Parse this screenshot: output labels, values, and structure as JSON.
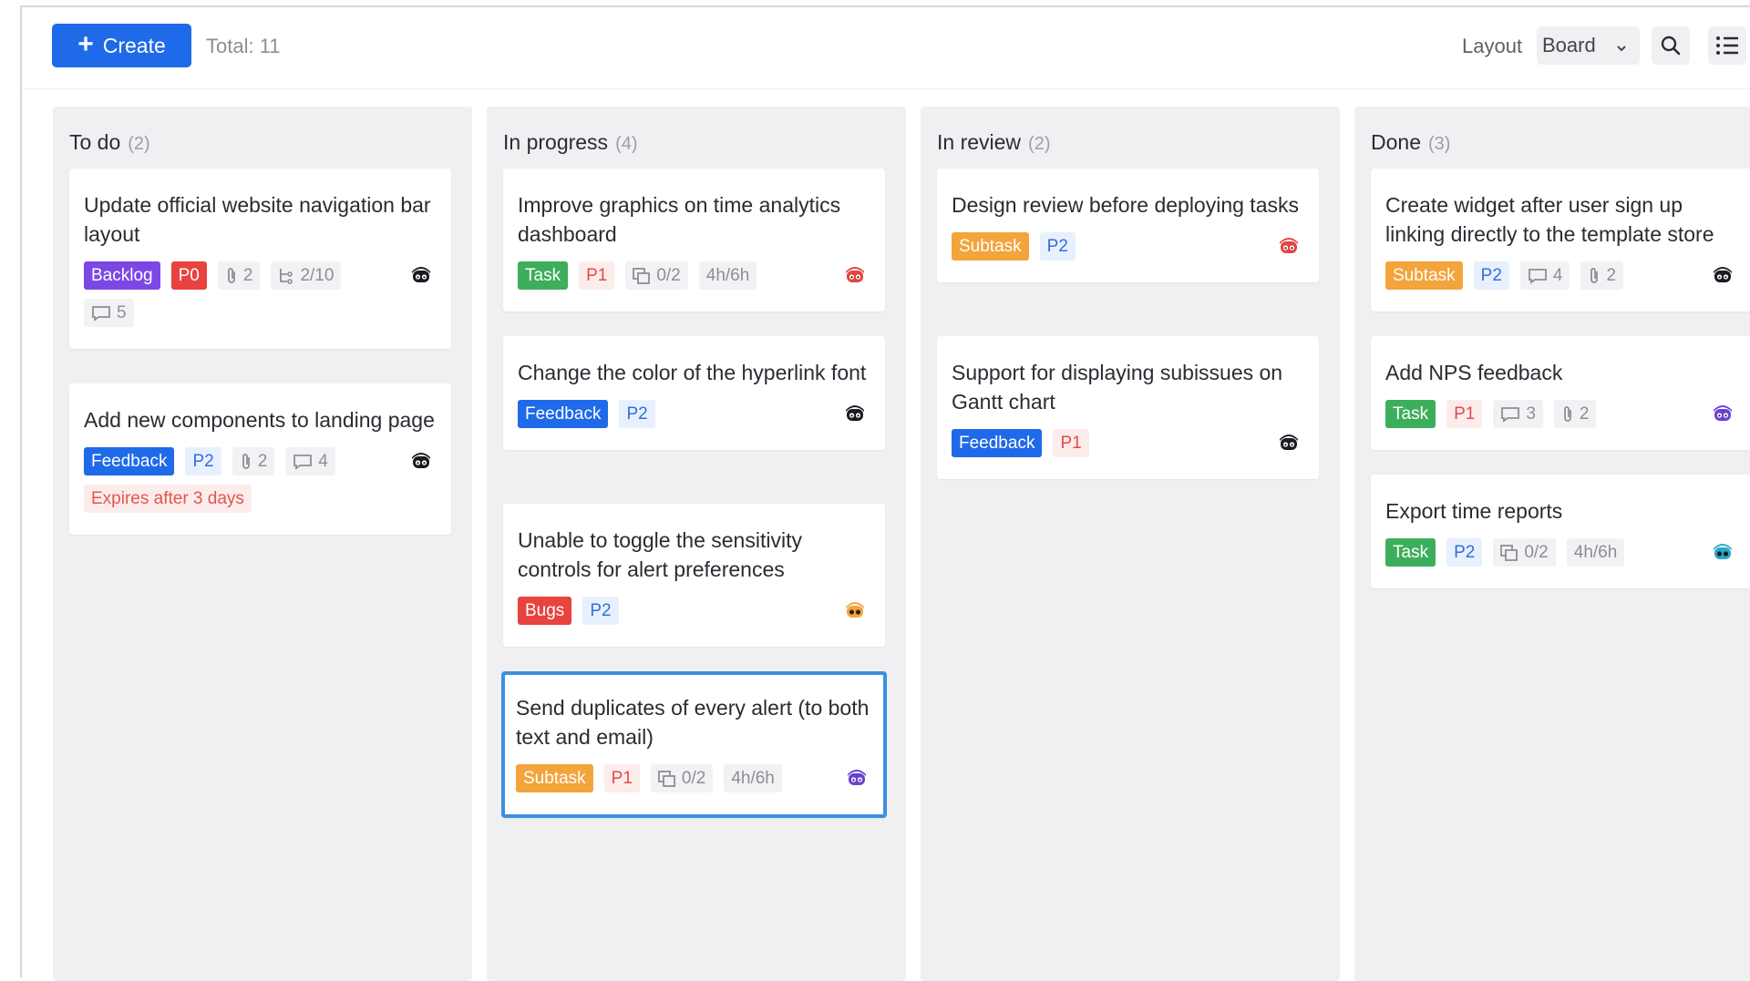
{
  "toolbar": {
    "create_label": "Create",
    "total": "Total: 11",
    "layout_label": "Layout",
    "layout_value": "Board"
  },
  "colors": {
    "accent": "#1f6ae8",
    "backlog": "#7b48e6",
    "p0": "#e8433f",
    "task": "#3dae5c",
    "subtask": "#f3a43a",
    "selected_border": "#3b8fe0"
  },
  "columns": [
    {
      "title": "To do",
      "count": "(2)",
      "cards": [
        {
          "title": "Update official website navigation bar layout",
          "tags": [
            {
              "text": "Backlog",
              "kind": "backlog"
            },
            {
              "text": "P0",
              "kind": "p0"
            },
            {
              "text": "2",
              "kind": "meta",
              "icon": "attachment-icon"
            },
            {
              "text": "2/10",
              "kind": "meta",
              "icon": "subtask-tree-icon"
            },
            {
              "text": "5",
              "kind": "meta",
              "icon": "comment-icon"
            }
          ],
          "avatar": "avatar-dark"
        },
        {
          "title": "Add new components to landing page",
          "tags": [
            {
              "text": "Feedback",
              "kind": "feedback"
            },
            {
              "text": "P2",
              "kind": "p2"
            },
            {
              "text": "2",
              "kind": "meta",
              "icon": "attachment-icon"
            },
            {
              "text": "4",
              "kind": "meta",
              "icon": "comment-icon"
            },
            {
              "text": "Expires after 3 days",
              "kind": "expire"
            }
          ],
          "avatar": "avatar-dark"
        }
      ]
    },
    {
      "title": "In progress",
      "count": "(4)",
      "cards": [
        {
          "title": "Improve graphics on time analytics dashboard",
          "tags": [
            {
              "text": "Task",
              "kind": "task"
            },
            {
              "text": "P1",
              "kind": "p1"
            },
            {
              "text": "0/2",
              "kind": "meta",
              "icon": "copy-icon"
            },
            {
              "text": "4h/6h",
              "kind": "meta"
            }
          ],
          "avatar": "avatar-red"
        },
        {
          "title": "Change the color of the hyperlink font",
          "tags": [
            {
              "text": "Feedback",
              "kind": "feedback"
            },
            {
              "text": "P2",
              "kind": "p2"
            }
          ],
          "avatar": "avatar-dark"
        },
        {
          "title": "Unable to toggle the sensitivity controls for alert preferences",
          "tags": [
            {
              "text": "Bugs",
              "kind": "bugs"
            },
            {
              "text": "P2",
              "kind": "p2"
            }
          ],
          "avatar": "avatar-orange"
        },
        {
          "title": "Send duplicates of every alert (to both text and email)",
          "tags": [
            {
              "text": "Subtask",
              "kind": "subtask"
            },
            {
              "text": "P1",
              "kind": "p1"
            },
            {
              "text": "0/2",
              "kind": "meta",
              "icon": "copy-icon"
            },
            {
              "text": "4h/6h",
              "kind": "meta"
            }
          ],
          "avatar": "avatar-purple",
          "selected": true
        }
      ]
    },
    {
      "title": "In review",
      "count": "(2)",
      "cards": [
        {
          "title": "Design review before deploying tasks",
          "tags": [
            {
              "text": "Subtask",
              "kind": "subtask"
            },
            {
              "text": "P2",
              "kind": "p2"
            }
          ],
          "avatar": "avatar-red"
        },
        {
          "title": "Support for displaying subissues on Gantt chart",
          "tags": [
            {
              "text": "Feedback",
              "kind": "feedback"
            },
            {
              "text": "P1",
              "kind": "p1"
            }
          ],
          "avatar": "avatar-dark"
        }
      ]
    },
    {
      "title": "Done",
      "count": "(3)",
      "cards": [
        {
          "title": "Create widget after user sign up linking directly to the template store",
          "tags": [
            {
              "text": "Subtask",
              "kind": "subtask"
            },
            {
              "text": "P2",
              "kind": "p2"
            },
            {
              "text": "4",
              "kind": "meta",
              "icon": "comment-icon"
            },
            {
              "text": "2",
              "kind": "meta",
              "icon": "attachment-icon"
            }
          ],
          "avatar": "avatar-dark"
        },
        {
          "title": "Add NPS feedback",
          "tags": [
            {
              "text": "Task",
              "kind": "task"
            },
            {
              "text": "P1",
              "kind": "p1"
            },
            {
              "text": "3",
              "kind": "meta",
              "icon": "comment-icon"
            },
            {
              "text": "2",
              "kind": "meta",
              "icon": "attachment-icon"
            }
          ],
          "avatar": "avatar-purple"
        },
        {
          "title": "Export time reports",
          "tags": [
            {
              "text": "Task",
              "kind": "task"
            },
            {
              "text": "P2",
              "kind": "p2"
            },
            {
              "text": "0/2",
              "kind": "meta",
              "icon": "copy-icon"
            },
            {
              "text": "4h/6h",
              "kind": "meta"
            }
          ],
          "avatar": "avatar-teal"
        }
      ]
    }
  ]
}
